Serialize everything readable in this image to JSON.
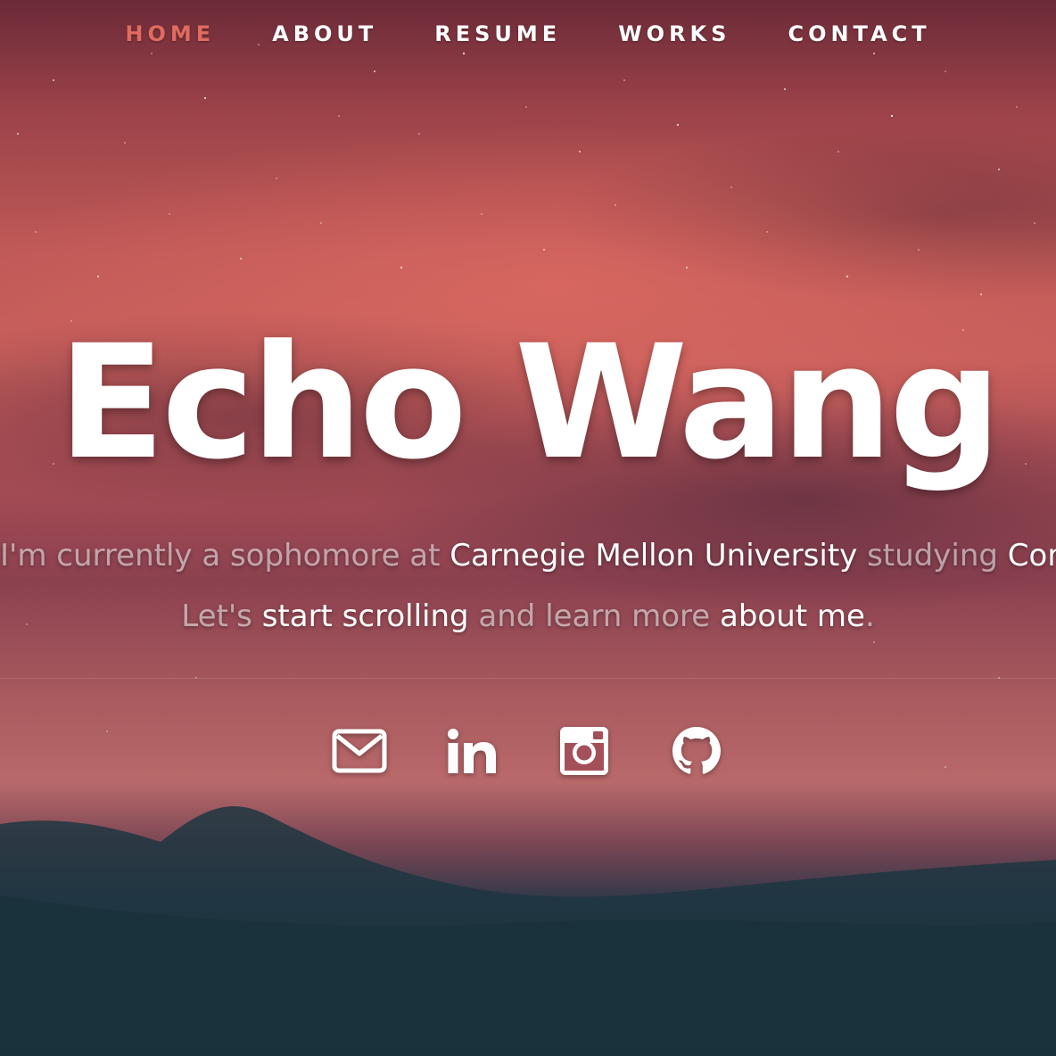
{
  "nav": {
    "items": [
      {
        "label": "HOME",
        "active": true
      },
      {
        "label": "ABOUT",
        "active": false
      },
      {
        "label": "RESUME",
        "active": false
      },
      {
        "label": "WORKS",
        "active": false
      },
      {
        "label": "CONTACT",
        "active": false
      }
    ],
    "active_color": "#e06b5f"
  },
  "hero": {
    "name": "Echo Wang",
    "line1": {
      "part1": "I'm currently a sophomore at ",
      "school": "Carnegie Mellon University",
      "part2": " studying ",
      "major": "Computer Science"
    },
    "line2": {
      "part1": "Let's ",
      "part2": "start scrolling",
      "part3": " and learn more ",
      "part4": "about me",
      "part5": "."
    }
  },
  "social": [
    {
      "name": "email",
      "icon": "envelope-icon"
    },
    {
      "name": "linkedin",
      "icon": "linkedin-icon"
    },
    {
      "name": "instagram",
      "icon": "instagram-icon"
    },
    {
      "name": "github",
      "icon": "github-icon"
    }
  ]
}
